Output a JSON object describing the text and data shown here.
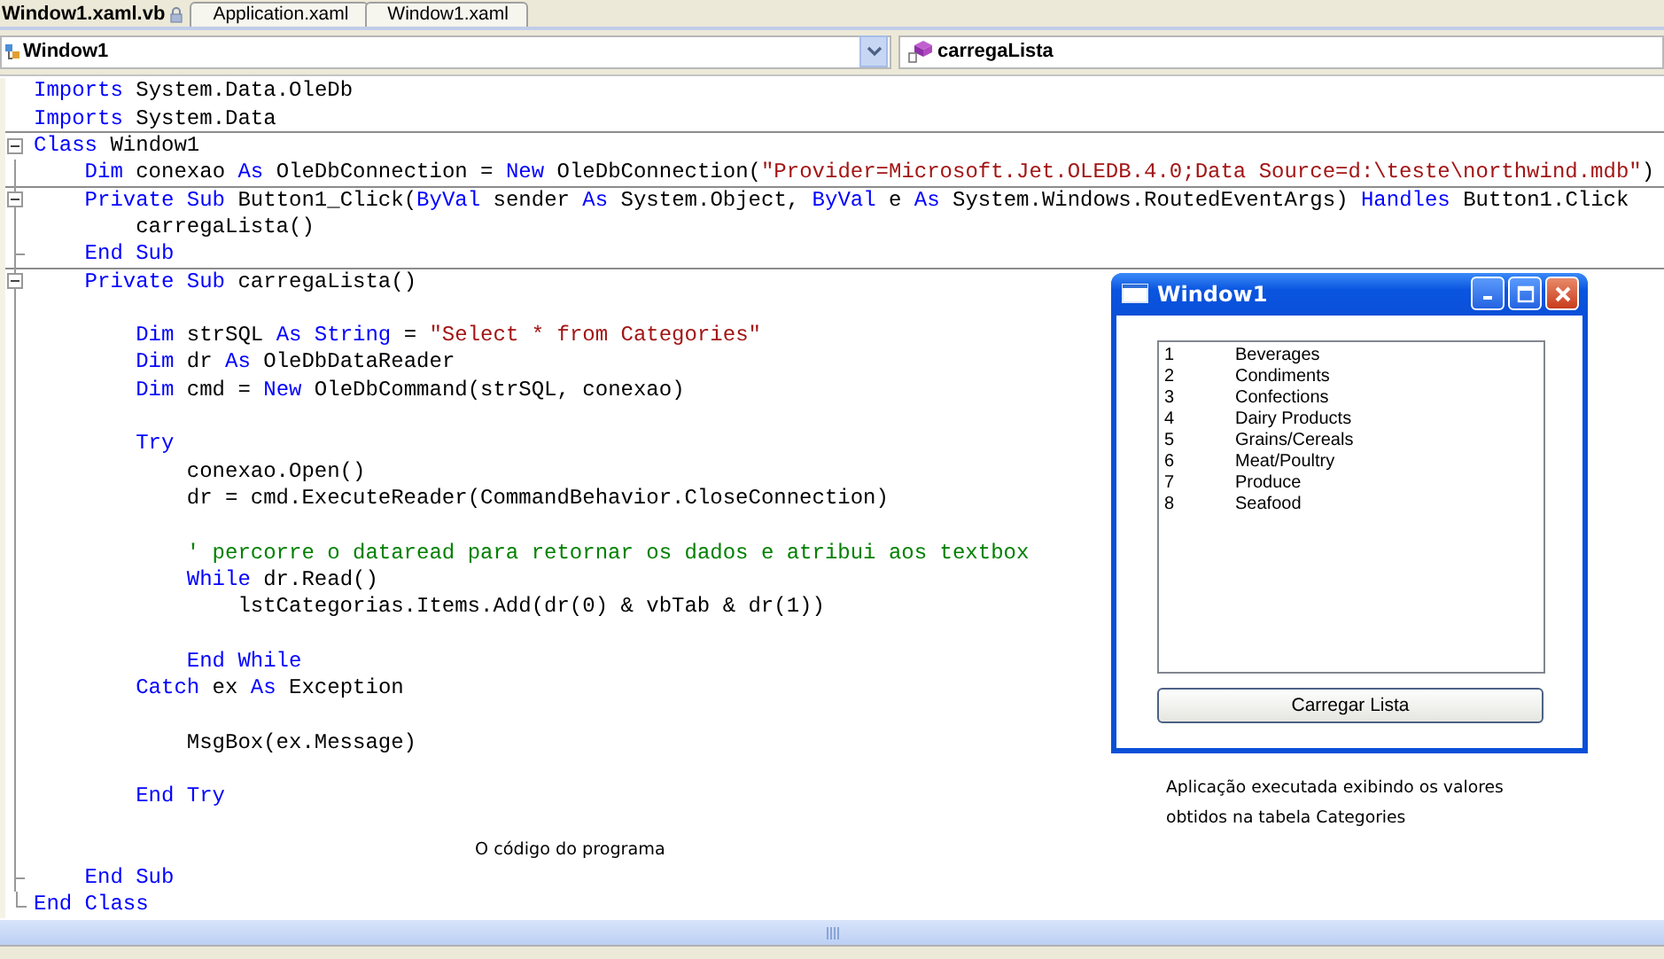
{
  "tabs": [
    {
      "label": "Window1.xaml.vb",
      "selected": true,
      "locked": true
    },
    {
      "label": "Application.xaml",
      "selected": false,
      "locked": false
    },
    {
      "label": "Window1.xaml",
      "selected": false,
      "locked": false
    }
  ],
  "navigation": {
    "class_dropdown": "Window1",
    "method_dropdown": "carregaLista"
  },
  "code_lines": [
    {
      "kind": "code",
      "tokens": [
        {
          "kind": "keyword",
          "text": "Imports"
        },
        {
          "kind": "plain",
          "text": " System.Data.OleDb"
        }
      ]
    },
    {
      "kind": "code",
      "tokens": [
        {
          "kind": "keyword",
          "text": "Imports"
        },
        {
          "kind": "plain",
          "text": " System.Data"
        }
      ]
    },
    {
      "kind": "code",
      "collapsible": true,
      "divider_above": true,
      "tokens": [
        {
          "kind": "keyword",
          "text": "Class"
        },
        {
          "kind": "plain",
          "text": " Window1"
        }
      ],
      "children": [
        {
          "kind": "code",
          "tokens": [
            {
              "kind": "keyword",
              "text": "Dim"
            },
            {
              "kind": "plain",
              "text": " conexao "
            },
            {
              "kind": "keyword",
              "text": "As"
            },
            {
              "kind": "plain",
              "text": " OleDbConnection = "
            },
            {
              "kind": "keyword",
              "text": "New"
            },
            {
              "kind": "plain",
              "text": " OleDbConnection("
            },
            {
              "kind": "string",
              "text": "\"Provider=Microsoft.Jet.OLEDB.4.0;Data Source=d:\\teste\\northwind.mdb\""
            },
            {
              "kind": "plain",
              "text": ")"
            }
          ]
        },
        {
          "kind": "code",
          "collapsible": true,
          "divider_above": true,
          "tokens": [
            {
              "kind": "keyword",
              "text": "Private Sub"
            },
            {
              "kind": "plain",
              "text": " Button1_Click("
            },
            {
              "kind": "keyword",
              "text": "ByVal"
            },
            {
              "kind": "plain",
              "text": " sender "
            },
            {
              "kind": "keyword",
              "text": "As"
            },
            {
              "kind": "plain",
              "text": " System.Object, "
            },
            {
              "kind": "keyword",
              "text": "ByVal"
            },
            {
              "kind": "plain",
              "text": " e "
            },
            {
              "kind": "keyword",
              "text": "As"
            },
            {
              "kind": "plain",
              "text": " System.Windows.RoutedEventArgs) "
            },
            {
              "kind": "keyword",
              "text": "Handles"
            },
            {
              "kind": "plain",
              "text": " Button1.Click"
            }
          ],
          "children": [
            {
              "kind": "code",
              "tokens": [
                {
                  "kind": "plain",
                  "text": "carregaLista()"
                }
              ]
            }
          ]
        },
        {
          "kind": "code",
          "fold_end": true,
          "tokens": [
            {
              "kind": "keyword",
              "text": "End Sub"
            }
          ]
        },
        {
          "kind": "code",
          "collapsible": true,
          "divider_above": true,
          "tokens": [
            {
              "kind": "keyword",
              "text": "Private Sub"
            },
            {
              "kind": "plain",
              "text": " carregaLista()"
            }
          ],
          "children": [
            {
              "kind": "blank"
            },
            {
              "kind": "code",
              "tokens": [
                {
                  "kind": "keyword",
                  "text": "Dim"
                },
                {
                  "kind": "plain",
                  "text": " strSQL "
                },
                {
                  "kind": "keyword",
                  "text": "As String"
                },
                {
                  "kind": "plain",
                  "text": " = "
                },
                {
                  "kind": "string",
                  "text": "\"Select * from Categories\""
                }
              ]
            },
            {
              "kind": "code",
              "tokens": [
                {
                  "kind": "keyword",
                  "text": "Dim"
                },
                {
                  "kind": "plain",
                  "text": " dr "
                },
                {
                  "kind": "keyword",
                  "text": "As"
                },
                {
                  "kind": "plain",
                  "text": " OleDbDataReader"
                }
              ]
            },
            {
              "kind": "code",
              "tokens": [
                {
                  "kind": "keyword",
                  "text": "Dim"
                },
                {
                  "kind": "plain",
                  "text": " cmd = "
                },
                {
                  "kind": "keyword",
                  "text": "New"
                },
                {
                  "kind": "plain",
                  "text": " OleDbCommand(strSQL, conexao)"
                }
              ]
            },
            {
              "kind": "blank"
            },
            {
              "kind": "code",
              "tokens": [
                {
                  "kind": "keyword",
                  "text": "Try"
                }
              ],
              "children": [
                {
                  "kind": "code",
                  "tokens": [
                    {
                      "kind": "plain",
                      "text": "conexao.Open()"
                    }
                  ]
                },
                {
                  "kind": "code",
                  "tokens": [
                    {
                      "kind": "plain",
                      "text": "dr = cmd.ExecuteReader(CommandBehavior.CloseConnection)"
                    }
                  ]
                },
                {
                  "kind": "blank"
                },
                {
                  "kind": "code",
                  "tokens": [
                    {
                      "kind": "comment",
                      "text": "' percorre o dataread para retornar os dados e atribui aos textbox"
                    }
                  ]
                },
                {
                  "kind": "code",
                  "tokens": [
                    {
                      "kind": "keyword",
                      "text": "While"
                    },
                    {
                      "kind": "plain",
                      "text": " dr.Read()"
                    }
                  ],
                  "children": [
                    {
                      "kind": "code",
                      "tokens": [
                        {
                          "kind": "plain",
                          "text": "lstCategorias.Items.Add(dr(0) & vbTab & dr(1))"
                        }
                      ]
                    },
                    {
                      "kind": "blank"
                    }
                  ]
                },
                {
                  "kind": "code",
                  "tokens": [
                    {
                      "kind": "keyword",
                      "text": "End While"
                    }
                  ]
                }
              ]
            },
            {
              "kind": "code",
              "tokens": [
                {
                  "kind": "keyword",
                  "text": "Catch"
                },
                {
                  "kind": "plain",
                  "text": " ex "
                },
                {
                  "kind": "keyword",
                  "text": "As"
                },
                {
                  "kind": "plain",
                  "text": " Exception"
                }
              ],
              "children": [
                {
                  "kind": "blank"
                },
                {
                  "kind": "code",
                  "tokens": [
                    {
                      "kind": "plain",
                      "text": "MsgBox(ex.Message)"
                    }
                  ]
                },
                {
                  "kind": "blank"
                }
              ]
            },
            {
              "kind": "code",
              "tokens": [
                {
                  "kind": "keyword",
                  "text": "End Try"
                }
              ]
            },
            {
              "kind": "blank"
            },
            {
              "kind": "caption",
              "text": "O código do programa"
            }
          ]
        },
        {
          "kind": "code",
          "fold_end": true,
          "tokens": [
            {
              "kind": "keyword",
              "text": "End Sub"
            }
          ]
        }
      ]
    },
    {
      "kind": "code",
      "fold_end": true,
      "tokens": [
        {
          "kind": "keyword",
          "text": "End Class"
        }
      ]
    }
  ],
  "app_window": {
    "title": "Window1",
    "list_items": [
      {
        "id": "1",
        "name": "Beverages"
      },
      {
        "id": "2",
        "name": "Condiments"
      },
      {
        "id": "3",
        "name": "Confections"
      },
      {
        "id": "4",
        "name": "Dairy Products"
      },
      {
        "id": "5",
        "name": "Grains/Cereals"
      },
      {
        "id": "6",
        "name": "Meat/Poultry"
      },
      {
        "id": "7",
        "name": "Produce"
      },
      {
        "id": "8",
        "name": "Seafood"
      }
    ],
    "button": "Carregar Lista"
  },
  "app_caption": "Aplicação executada exibindo os valores obtidos na tabela Categories"
}
